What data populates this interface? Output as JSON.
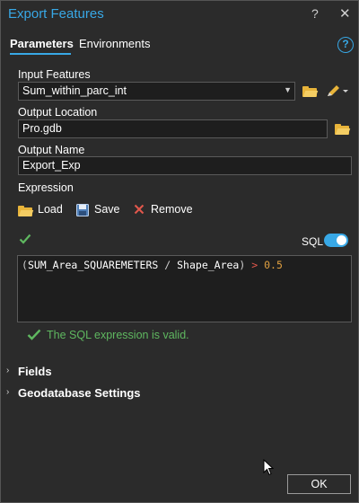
{
  "window": {
    "title": "Export Features",
    "help_glyph": "?",
    "close_glyph": "✕"
  },
  "tabs": [
    {
      "label": "Parameters",
      "active": true
    },
    {
      "label": "Environments",
      "active": false
    }
  ],
  "help_circle_glyph": "?",
  "params": {
    "input_features": {
      "label": "Input Features",
      "value": "Sum_within_parc_int"
    },
    "output_location": {
      "label": "Output Location",
      "value": "Pro.gdb"
    },
    "output_name": {
      "label": "Output Name",
      "value": "Export_Exp"
    },
    "expression": {
      "label": "Expression"
    }
  },
  "expression_toolbar": {
    "load_label": "Load",
    "save_label": "Save",
    "remove_label": "Remove"
  },
  "sql_toggle": {
    "label": "SQL",
    "on": true
  },
  "expression_text": {
    "open_paren": "(",
    "field1": "SUM_Area_SQUAREMETERS",
    "operator": " / ",
    "field2": "Shape_Area",
    "close_paren": ")",
    "comparison": " > ",
    "value": "0.5"
  },
  "validation_message": "The SQL expression is valid.",
  "sections": [
    {
      "label": "Fields"
    },
    {
      "label": "Geodatabase Settings"
    }
  ],
  "ok_label": "OK",
  "colors": {
    "accent": "#38a8e6",
    "background": "#2b2b2b",
    "field_bg": "#1e1e1e",
    "success": "#5fb860",
    "folder": "#e8b43a",
    "remove": "#e2574c"
  }
}
